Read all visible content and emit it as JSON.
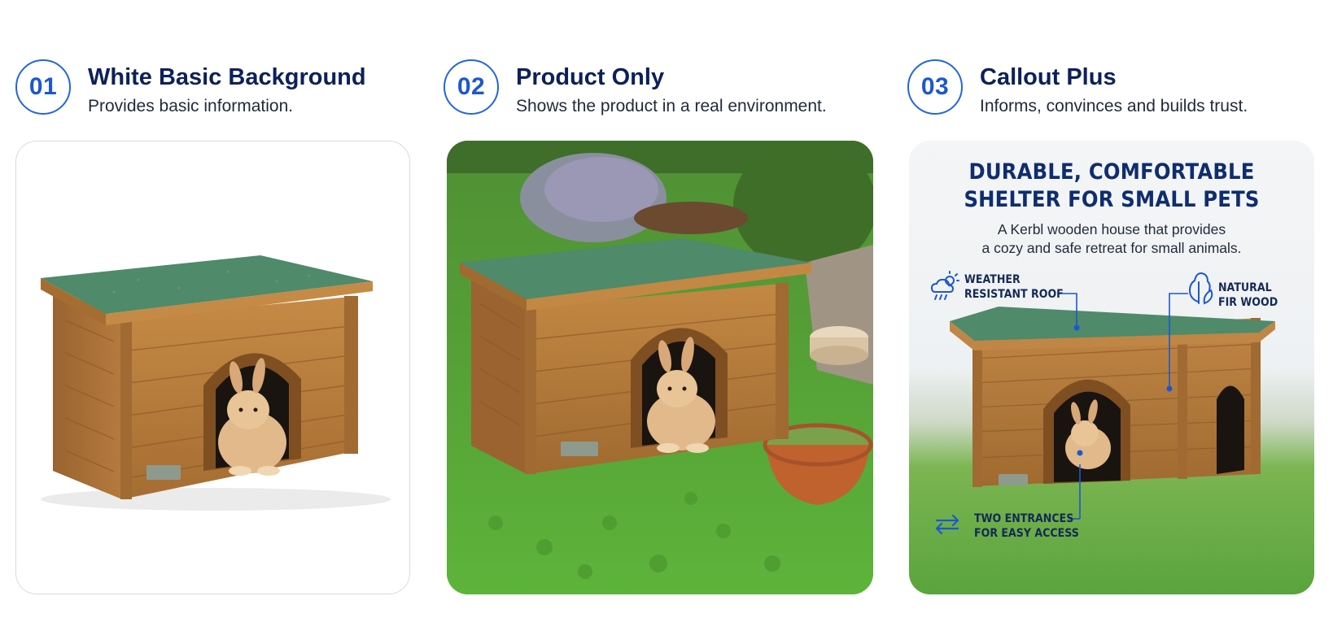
{
  "panels": [
    {
      "number": "01",
      "title": "White Basic Background",
      "subtitle": "Provides basic information."
    },
    {
      "number": "02",
      "title": "Product Only",
      "subtitle": "Shows the product in a real environment."
    },
    {
      "number": "03",
      "title": "Callout Plus",
      "subtitle": "Informs, convinces and builds trust."
    }
  ],
  "callout_card": {
    "headline_line1": "DURABLE, COMFORTABLE",
    "headline_line2": "SHELTER FOR SMALL PETS",
    "desc_line1": "A Kerbl wooden house that provides",
    "desc_line2": "a cozy and safe retreat for small animals.",
    "callouts": {
      "weather_line1": "WEATHER",
      "weather_line2": "RESISTANT ROOF",
      "wood_line1": "NATURAL",
      "wood_line2": "FIR WOOD",
      "entrances_line1": "TWO ENTRANCES",
      "entrances_line2": "FOR EASY ACCESS"
    },
    "accent_color": "#1c58cf"
  },
  "colors": {
    "brand_blue": "#1c58cf",
    "navy": "#0c2159",
    "wood": "#b37a3a",
    "roof": "#4f8a6a",
    "grass": "#5aa43d"
  },
  "icons": [
    "weather-cloud-icon",
    "tree-icon",
    "double-arrow-icon"
  ]
}
